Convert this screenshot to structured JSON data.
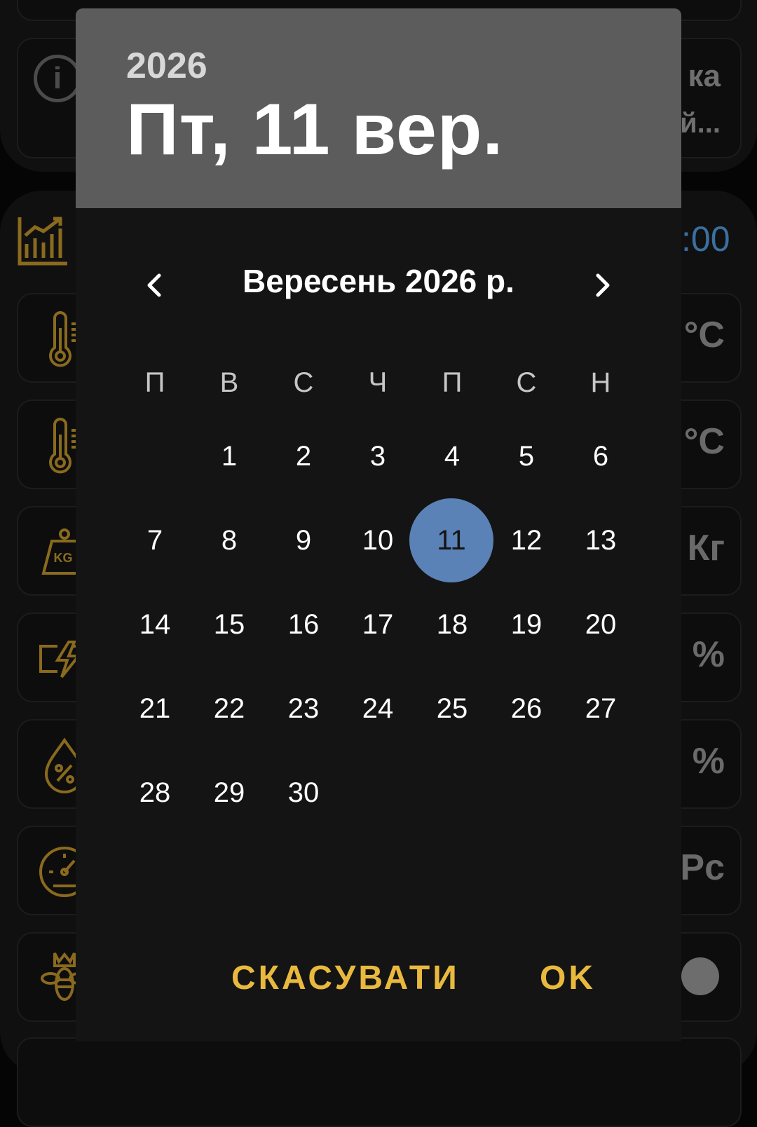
{
  "background": {
    "info_peek_line1": "ка",
    "info_peek_line2": "й...",
    "clock_peek": ":00",
    "rows": [
      {
        "icon": "thermometer-icon",
        "unit": "°C"
      },
      {
        "icon": "thermometer-icon",
        "unit": "°C"
      },
      {
        "icon": "weight-kg-icon",
        "unit": "Кг",
        "icon_text": "KG"
      },
      {
        "icon": "battery-charge-icon",
        "unit": "%"
      },
      {
        "icon": "humidity-icon",
        "unit": "%"
      },
      {
        "icon": "pressure-gauge-icon",
        "unit": "Рс"
      },
      {
        "icon": "queen-bee-icon",
        "unit": ""
      }
    ],
    "accent_color": "#8a6a1e"
  },
  "dialog": {
    "year": "2026",
    "selected_date": "Пт, 11 вер.",
    "month_label": "Вересень 2026 р.",
    "prev_icon": "chevron-left-icon",
    "next_icon": "chevron-right-icon",
    "weekdays": [
      "П",
      "В",
      "С",
      "Ч",
      "П",
      "С",
      "Н"
    ],
    "days": [
      "1",
      "2",
      "3",
      "4",
      "5",
      "6",
      "7",
      "8",
      "9",
      "10",
      "11",
      "12",
      "13",
      "14",
      "15",
      "16",
      "17",
      "18",
      "19",
      "20",
      "21",
      "22",
      "23",
      "24",
      "25",
      "26",
      "27",
      "28",
      "29",
      "30"
    ],
    "first_weekday_offset": 1,
    "selected_day": "11",
    "selected_color": "#5b82b6",
    "cancel_label": "СКАСУВАТИ",
    "ok_label": "OK",
    "button_color": "#e9b93e"
  }
}
